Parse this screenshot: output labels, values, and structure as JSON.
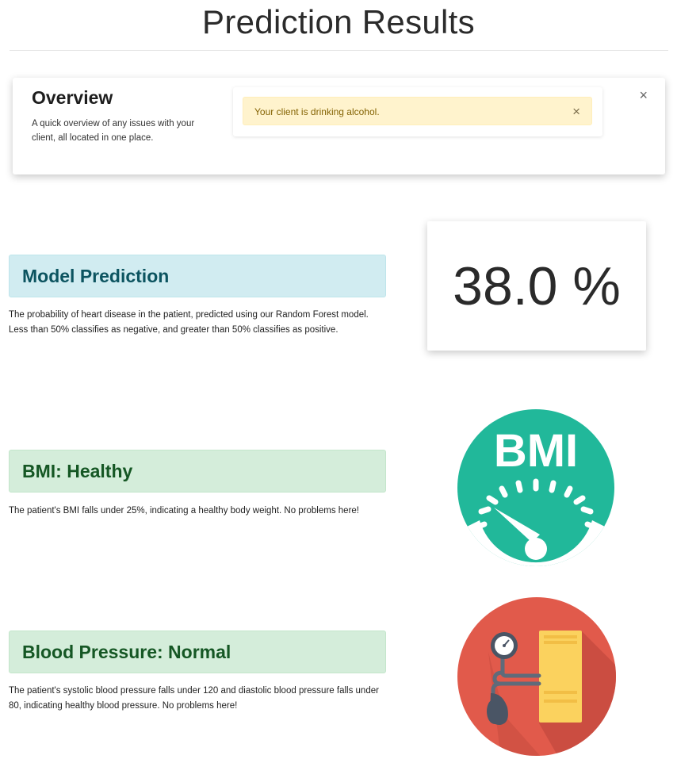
{
  "page": {
    "title": "Prediction Results"
  },
  "overview": {
    "heading": "Overview",
    "description": "A quick overview of any issues with your client, all located in one place.",
    "close_glyph": "×",
    "alert": {
      "text": "Your client is drinking alcohol.",
      "close_glyph": "×",
      "color": "#fff3cd"
    }
  },
  "model": {
    "heading": "Model Prediction",
    "description": "The probability of heart disease in the patient, predicted using our Random Forest model. Less than 50% classifies as negative, and greater than 50% classifies as positive.",
    "value": "38.0 %",
    "color": "#d1ecf1"
  },
  "bmi": {
    "heading": "BMI: Healthy",
    "description": "The patient's BMI falls under 25%, indicating a healthy body weight. No problems here!",
    "icon": "bmi-gauge-icon",
    "icon_text": "BMI",
    "color": "#d4edda",
    "icon_color": "#21b89a"
  },
  "bp": {
    "heading": "Blood Pressure: Normal",
    "description": "The patient's systolic blood pressure falls under 120 and diastolic blood pressure falls under 80, indicating healthy blood pressure. No problems here!",
    "icon": "blood-pressure-monitor-icon",
    "color": "#d4edda",
    "icon_color": "#e15a4b"
  }
}
